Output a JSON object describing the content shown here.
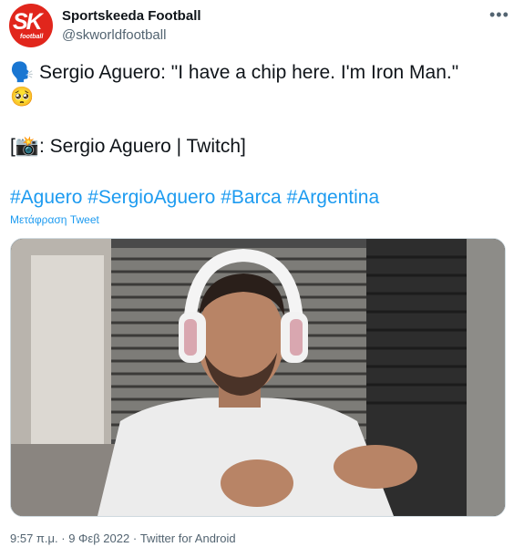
{
  "author": {
    "avatar_text": "SK",
    "avatar_sub": "football",
    "name": "Sportskeeda Football",
    "handle": "@skworldfootball"
  },
  "menu_icon": "more-horizontal-icon",
  "tweet": {
    "line1_emoji": "🗣️",
    "line1_text": "Sergio Aguero: \"I have a chip here. I'm Iron Man.\"",
    "line2_emoji": "🥺",
    "line3_prefix": "[",
    "line3_emoji": "📸",
    "line3_text": ": Sergio Aguero | Twitch]",
    "hashtags": [
      "#Aguero",
      "#SergioAguero",
      "#Barca",
      "#Argentina"
    ],
    "translate_label": "Μετάφραση Tweet"
  },
  "media": {
    "alt": "video still of man wearing white headset pointing at his chest"
  },
  "meta": {
    "time": "9:57 π.μ.",
    "separator1": "·",
    "date": "9 Φεβ 2022",
    "separator2": "·",
    "client": "Twitter for Android"
  },
  "colors": {
    "link": "#1d9bf0",
    "secondary": "#536471",
    "brand": "#e1261c"
  }
}
